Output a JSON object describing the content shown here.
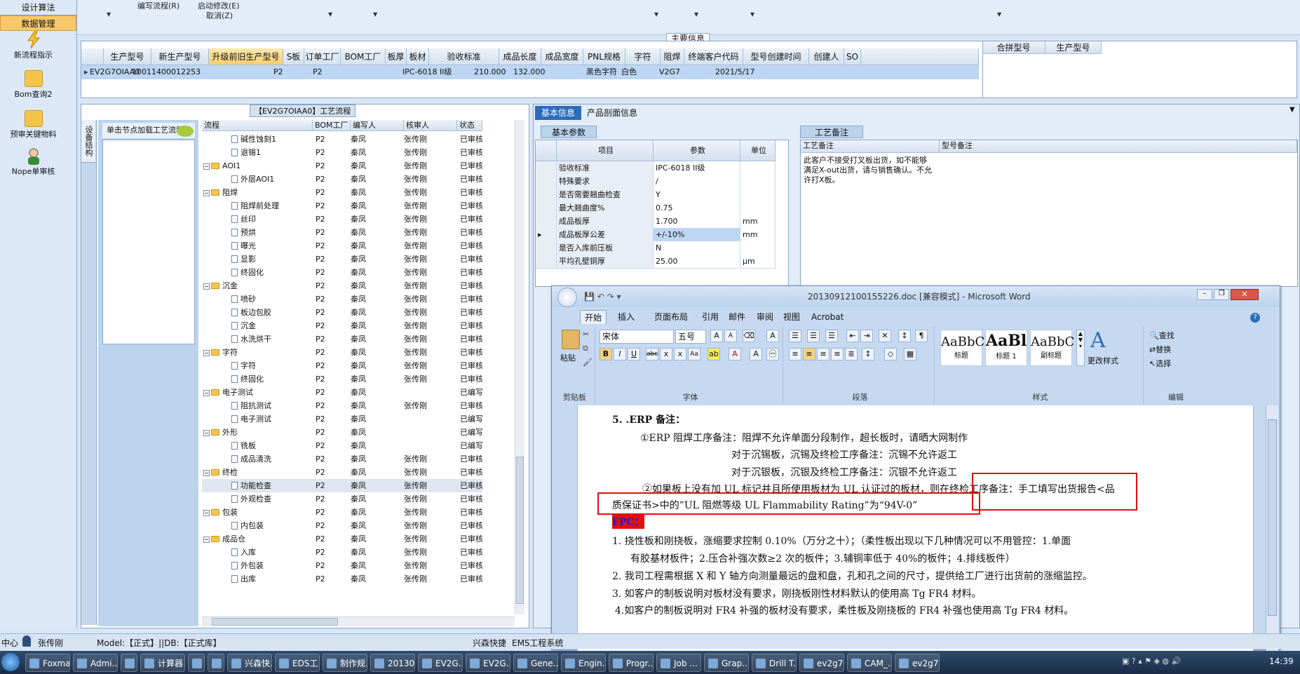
{
  "leftnav": {
    "top_item": "设计算法",
    "selected_item": "数据管理",
    "items": [
      {
        "label": "新流程指示",
        "icon": "lightning-icon"
      },
      {
        "label": "Bom查询2",
        "icon": "folder-icon"
      },
      {
        "label": "预审关键物料",
        "icon": "folder-icon"
      },
      {
        "label": "Nope单审核",
        "icon": "user-icon"
      }
    ]
  },
  "toolbar": {
    "row1": [
      "编写流程(R)",
      "启动修改(E)"
    ],
    "row2": [
      "取消(Z)"
    ]
  },
  "grid": {
    "group_title": "主要信息",
    "columns": [
      "生产型号",
      "新生产型号",
      "升级前旧生产型号",
      "S板",
      "订单工厂",
      "BOM工厂",
      "板厚",
      "板材",
      "验收标准",
      "成品长度",
      "成品宽度",
      "PNL规格",
      "字符",
      "阻焊",
      "终端客户代码",
      "型号创建时间",
      "创建人",
      "SO"
    ],
    "extra_columns": [
      "合拼型号",
      "生产型号"
    ],
    "row": [
      "EV2G7OIAA0",
      "10011400012253",
      "",
      "",
      "P2",
      "P2",
      "",
      "",
      "IPC-6018 II级",
      "210.000",
      "132.000",
      "",
      "黑色字符",
      "白色",
      "V2G7",
      "2021/5/17",
      "",
      ""
    ]
  },
  "tree": {
    "title": "【EV2G7OIAA0】工艺流程",
    "vertical_tab": "设备结构",
    "hint": "单击节点加载工艺流程",
    "headers": [
      "流程",
      "BOM工厂",
      "编写人",
      "核审人",
      "状态"
    ],
    "rows": [
      {
        "name": "碱性蚀刻1",
        "level": 2,
        "factory": "P2",
        "writer": "秦凤",
        "reviewer": "张传刚",
        "status": "已审核"
      },
      {
        "name": "退锡1",
        "level": 2,
        "factory": "P2",
        "writer": "秦凤",
        "reviewer": "张传刚",
        "status": "已审核"
      },
      {
        "name": "AOI1",
        "level": 1,
        "factory": "P2",
        "writer": "秦凤",
        "reviewer": "张传刚",
        "status": "已审核"
      },
      {
        "name": "外层AOI1",
        "level": 2,
        "factory": "P2",
        "writer": "秦凤",
        "reviewer": "张传刚",
        "status": "已审核"
      },
      {
        "name": "阻焊",
        "level": 1,
        "factory": "P2",
        "writer": "秦凤",
        "reviewer": "张传刚",
        "status": "已审核"
      },
      {
        "name": "阻焊前处理",
        "level": 2,
        "factory": "P2",
        "writer": "秦凤",
        "reviewer": "张传刚",
        "status": "已审核"
      },
      {
        "name": "丝印",
        "level": 2,
        "factory": "P2",
        "writer": "秦凤",
        "reviewer": "张传刚",
        "status": "已审核"
      },
      {
        "name": "预烘",
        "level": 2,
        "factory": "P2",
        "writer": "秦凤",
        "reviewer": "张传刚",
        "status": "已审核"
      },
      {
        "name": "曝光",
        "level": 2,
        "factory": "P2",
        "writer": "秦凤",
        "reviewer": "张传刚",
        "status": "已审核"
      },
      {
        "name": "显影",
        "level": 2,
        "factory": "P2",
        "writer": "秦凤",
        "reviewer": "张传刚",
        "status": "已审核"
      },
      {
        "name": "终固化",
        "level": 2,
        "factory": "P2",
        "writer": "秦凤",
        "reviewer": "张传刚",
        "status": "已审核"
      },
      {
        "name": "沉金",
        "level": 1,
        "factory": "P2",
        "writer": "秦凤",
        "reviewer": "张传刚",
        "status": "已审核"
      },
      {
        "name": "喷砂",
        "level": 2,
        "factory": "P2",
        "writer": "秦凤",
        "reviewer": "张传刚",
        "status": "已审核"
      },
      {
        "name": "板边包胶",
        "level": 2,
        "factory": "P2",
        "writer": "秦凤",
        "reviewer": "张传刚",
        "status": "已审核"
      },
      {
        "name": "沉金",
        "level": 2,
        "factory": "P2",
        "writer": "秦凤",
        "reviewer": "张传刚",
        "status": "已审核"
      },
      {
        "name": "水洗烘干",
        "level": 2,
        "factory": "P2",
        "writer": "秦凤",
        "reviewer": "张传刚",
        "status": "已审核"
      },
      {
        "name": "字符",
        "level": 1,
        "factory": "P2",
        "writer": "秦凤",
        "reviewer": "张传刚",
        "status": "已审核"
      },
      {
        "name": "字符",
        "level": 2,
        "factory": "P2",
        "writer": "秦凤",
        "reviewer": "张传刚",
        "status": "已审核"
      },
      {
        "name": "终固化",
        "level": 2,
        "factory": "P2",
        "writer": "秦凤",
        "reviewer": "张传刚",
        "status": "已审核"
      },
      {
        "name": "电子测试",
        "level": 1,
        "factory": "P2",
        "writer": "秦凤",
        "reviewer": "",
        "status": "已编写"
      },
      {
        "name": "阻抗测试",
        "level": 2,
        "factory": "P2",
        "writer": "秦凤",
        "reviewer": "张传刚",
        "status": "已审核"
      },
      {
        "name": "电子测试",
        "level": 2,
        "factory": "P2",
        "writer": "秦凤",
        "reviewer": "",
        "status": "已编写"
      },
      {
        "name": "外形",
        "level": 1,
        "factory": "P2",
        "writer": "秦凤",
        "reviewer": "",
        "status": "已编写"
      },
      {
        "name": "铣板",
        "level": 2,
        "factory": "P2",
        "writer": "秦凤",
        "reviewer": "",
        "status": "已编写"
      },
      {
        "name": "成品清洗",
        "level": 2,
        "factory": "P2",
        "writer": "秦凤",
        "reviewer": "张传刚",
        "status": "已审核"
      },
      {
        "name": "终检",
        "level": 1,
        "factory": "P2",
        "writer": "秦凤",
        "reviewer": "张传刚",
        "status": "已审核"
      },
      {
        "name": "功能检查",
        "level": 2,
        "factory": "P2",
        "writer": "秦凤",
        "reviewer": "张传刚",
        "status": "已审核"
      },
      {
        "name": "外观检查",
        "level": 2,
        "factory": "P2",
        "writer": "秦凤",
        "reviewer": "张传刚",
        "status": "已审核"
      },
      {
        "name": "包装",
        "level": 1,
        "factory": "P2",
        "writer": "秦凤",
        "reviewer": "张传刚",
        "status": "已审核"
      },
      {
        "name": "内包装",
        "level": 2,
        "factory": "P2",
        "writer": "秦凤",
        "reviewer": "张传刚",
        "status": "已审核"
      },
      {
        "name": "成品仓",
        "level": 1,
        "factory": "P2",
        "writer": "秦凤",
        "reviewer": "张传刚",
        "status": "已审核"
      },
      {
        "name": "入库",
        "level": 2,
        "factory": "P2",
        "writer": "秦凤",
        "reviewer": "张传刚",
        "status": "已审核"
      },
      {
        "name": "外包装",
        "level": 2,
        "factory": "P2",
        "writer": "秦凤",
        "reviewer": "张传刚",
        "status": "已审核"
      },
      {
        "name": "出库",
        "level": 2,
        "factory": "P2",
        "writer": "秦凤",
        "reviewer": "张传刚",
        "status": "已审核"
      }
    ]
  },
  "basic": {
    "tabs": [
      "基本信息",
      "产品剖面信息"
    ],
    "sub_tab": "基本参数",
    "headers": [
      "项目",
      "参数",
      "单位"
    ],
    "params": [
      {
        "item": "验收标准",
        "value": "IPC-6018 II级",
        "unit": ""
      },
      {
        "item": "特殊要求",
        "value": "/",
        "unit": ""
      },
      {
        "item": "是否需要翘曲检查",
        "value": "Y",
        "unit": ""
      },
      {
        "item": "最大翘曲度%",
        "value": "0.75",
        "unit": ""
      },
      {
        "item": "成品板厚",
        "value": "1.700",
        "unit": "mm"
      },
      {
        "item": "成品板厚公差",
        "value": "+/-10%",
        "unit": "mm"
      },
      {
        "item": "是否入库前压板",
        "value": "N",
        "unit": ""
      },
      {
        "item": "平均孔壁铜厚",
        "value": "25.00",
        "unit": "μm"
      }
    ],
    "process_tab": "工艺备注",
    "process_header": "工艺备注",
    "model_header": "型号备注",
    "process_note": "此客户不接受打叉板出货，如不能够满足X-out出货，请与销售确认。不允许打X板。"
  },
  "word": {
    "title": "20130912100155226.doc [兼容模式] - Microsoft Word",
    "tabs": [
      "开始",
      "插入",
      "页面布局",
      "引用",
      "邮件",
      "审阅",
      "视图",
      "Acrobat"
    ],
    "font_name": "宋体",
    "font_size": "五号",
    "groups": [
      "剪贴板",
      "字体",
      "段落",
      "样式",
      "编辑"
    ],
    "paste_label": "粘贴",
    "styles": [
      {
        "preview": "AaBbC",
        "label": "标题"
      },
      {
        "preview": "AaBl",
        "label": "标题 1"
      },
      {
        "preview": "AaBbC",
        "label": "副标题"
      }
    ],
    "change_style": "更改样式",
    "edit_items": [
      "查找",
      "替换",
      "选择"
    ],
    "lines": [
      "5. .ERP 备注：",
      "①ERP 阻焊工序备注：阻焊不允许单面分段制作，超长板时，请晒大网制作",
      "对于沉锡板，沉锡及终检工序备注：沉锡不允许返工",
      "对于沉银板，沉银及终检工序备注：沉银不允许返工",
      "②如果板上没有加 UL 标记并且所使用板材为 UL 认证过的板材，则在终检工序备注：手工填写出货报告<品",
      "质保证书>中的”UL 阻燃等级 UL Flammability Rating”为“94V-0”",
      "FPC：",
      "1.   挠性板和刚挠板，涨缩要求控制  0.10%（万分之十）；（柔性板出现以下几种情况可以不用管控：1.单面",
      "有胶基材板件；2.压合补强次数≥2 次的板件；3.辅铜率低于 40%的板件；4.排线板件）",
      "2.   我司工程需根据 X 和 Y 轴方向测量最远的盘和盘，孔和孔之间的尺寸，提供给工厂进行出货前的涨缩监控。",
      "3. 如客户的制板说明对板材没有要求，刚挠板刚性材料默认的使用高 Tg FR4 材料。",
      "4.如客户的制板说明对 FR4 补强的板材没有要求，柔性板及刚挠板的 FR4 补强也使用高 Tg FR4 材料。"
    ]
  },
  "status": {
    "center": "中心",
    "user": "张传刚",
    "model": "Model:【正式】||DB:【正式库】",
    "company": "兴森快捷",
    "system": "EMS工程系统"
  },
  "taskbar": {
    "items": [
      "Foxmail",
      "Admi...",
      "",
      "计算器",
      "",
      "",
      "兴森快...",
      "EDS工...",
      "制作规...",
      "20130...",
      "EV2G...",
      "EV2G...",
      "Gene...",
      "Engin...",
      "Progr...",
      "Job ...",
      "Grap...",
      "Drill T...",
      "ev2g7...",
      "CAM_...",
      "ev2g7..."
    ],
    "clock": "14:39"
  },
  "colors": {
    "selected_row": "#bcd6f3",
    "highlight_header": "#f8cf6c",
    "annotation": "#e01010",
    "fpc_label_bg": "#e01010"
  }
}
